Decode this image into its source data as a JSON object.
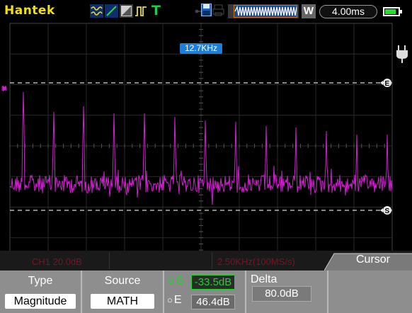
{
  "brand": "Hantek",
  "top_icons": [
    "fft-icon",
    "slope-icon",
    "display-icon",
    "pulse-icon",
    "trigger-icon"
  ],
  "trigger_letter": "T",
  "timebase": "4.00ms",
  "memory_badge": "W",
  "freq_marker": "12.7KHz",
  "cursor_marker_e": "E",
  "cursor_marker_s": "S",
  "info": {
    "channel": "CH1 20.0dB",
    "rate": "2.50KHz(100MS/s)",
    "mode": "Cursor"
  },
  "menu": {
    "type_title": "Type",
    "type_value": "Magnitude",
    "source_title": "Source",
    "source_value": "MATH",
    "s_label": "S",
    "s_value": "-33.5dB",
    "e_label": "E",
    "e_value": "46.4dB",
    "delta_title": "Delta",
    "delta_value": "80.0dB"
  },
  "colors": {
    "trace": "#d21fd2",
    "brand": "#f0e010",
    "trigger": "#19d42a",
    "accent": "#1f7fd8",
    "active_cursor": "#19d42a"
  },
  "battery_level": 0.85
}
